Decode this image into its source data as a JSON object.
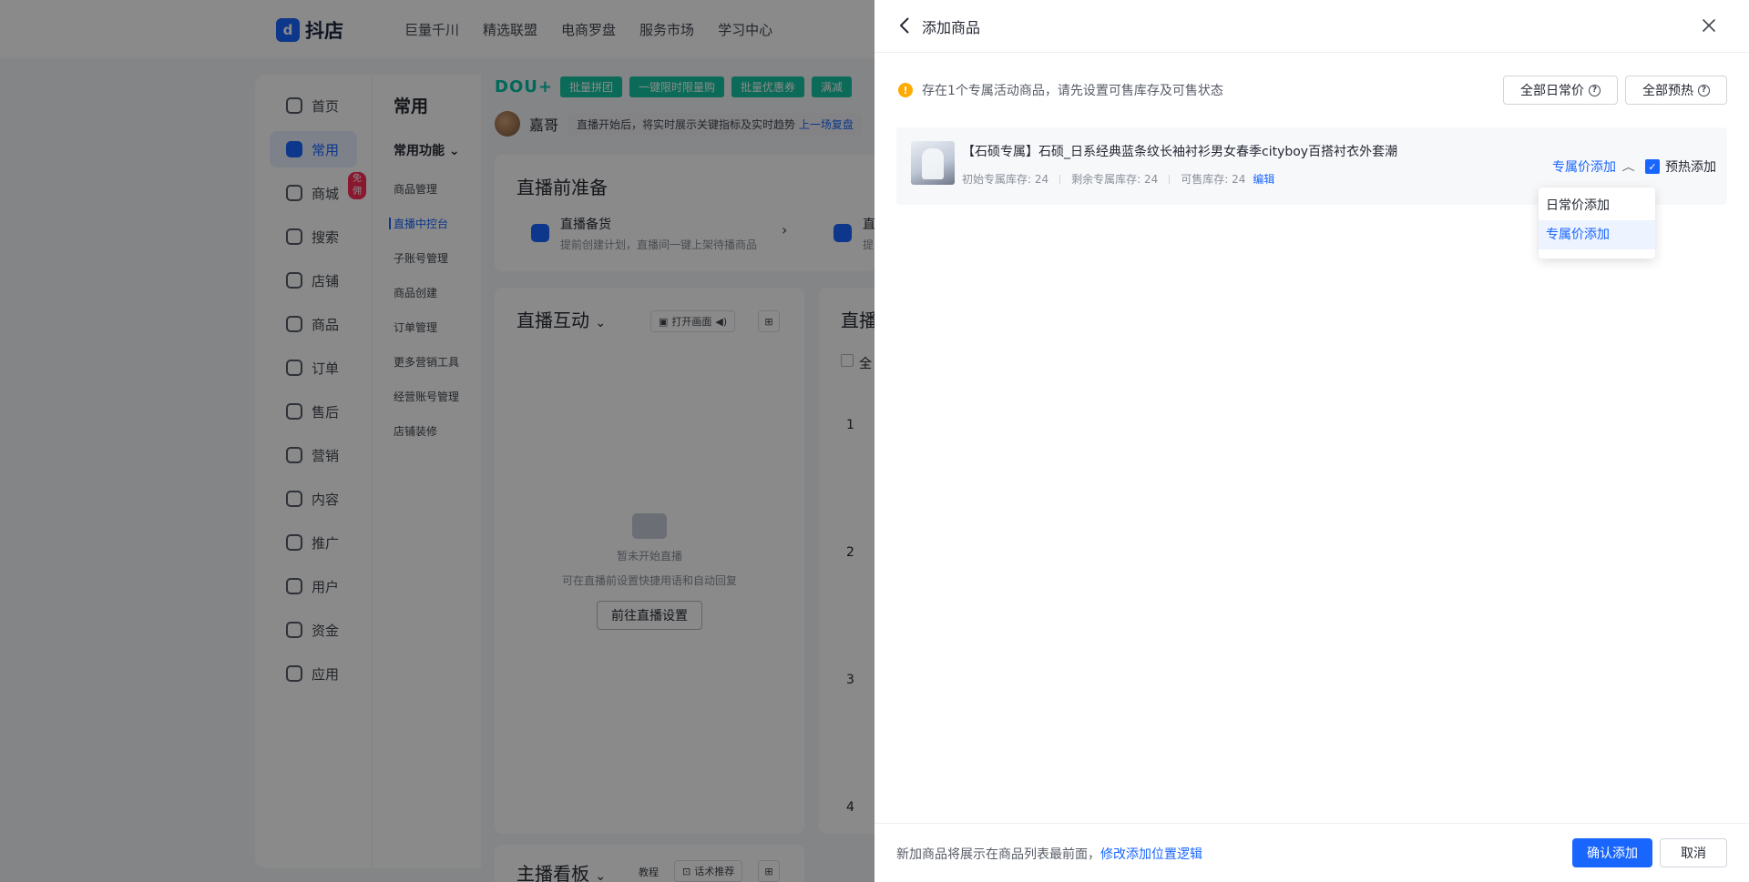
{
  "app": {
    "logo_text": "抖店",
    "top_nav": [
      "巨量千川",
      "精选联盟",
      "电商罗盘",
      "服务市场",
      "学习中心"
    ],
    "sidebar": [
      {
        "label": "首页"
      },
      {
        "label": "常用"
      },
      {
        "label": "商城",
        "badge": "免佣"
      },
      {
        "label": "搜索"
      },
      {
        "label": "店铺"
      },
      {
        "label": "商品"
      },
      {
        "label": "订单"
      },
      {
        "label": "售后"
      },
      {
        "label": "营销"
      },
      {
        "label": "内容"
      },
      {
        "label": "推广"
      },
      {
        "label": "用户"
      },
      {
        "label": "资金"
      },
      {
        "label": "应用"
      }
    ],
    "subnav": {
      "title": "常用",
      "group": "常用功能",
      "items": [
        "商品管理",
        "直播中控台",
        "子账号管理",
        "商品创建",
        "订单管理",
        "更多营销工具",
        "经营账号管理",
        "店铺装修"
      ]
    },
    "strip": {
      "brand": "DOU+",
      "buttons": [
        "批量拼团",
        "一键限时限量购",
        "批量优惠券",
        "满减"
      ]
    },
    "host": {
      "name": "嘉哥",
      "tip": "直播开始后，将实时展示关键指标及实时趋势",
      "tip_link": "上一场复盘"
    },
    "prep_card": {
      "title": "直播前准备",
      "item1_name": "直播备货",
      "item1_desc": "提前创建计划，直播间一键上架待播商品",
      "item2_name": "直",
      "item2_desc": "提"
    },
    "interact_card": {
      "title": "直播互动",
      "screen_btn": "打开画面",
      "empty_title": "暂未开始直播",
      "empty_desc": "可在直播前设置快捷用语和自动回复",
      "empty_btn": "前往直播设置"
    },
    "right_card": {
      "title": "直播",
      "check_label": "全",
      "rows": [
        "1",
        "2",
        "3",
        "4"
      ]
    },
    "board_card": {
      "title": "主播看板",
      "tutorial": "教程",
      "script_btn": "话术推荐"
    }
  },
  "drawer": {
    "title": "添加商品",
    "warning": "存在1个专属活动商品，请先设置可售库存及可售状态",
    "btn_daily_all": "全部日常价",
    "btn_preheat_all": "全部预热",
    "product": {
      "title": "【石硕专属】石硕_日系经典蓝条纹长袖衬衫男女春季cityboy百搭衬衣外套潮",
      "initial_stock": "初始专属库存: 24",
      "remaining_stock": "剩余专属库存: 24",
      "sellable_stock": "可售库存: 24",
      "edit": "编辑",
      "add_mode": "专属价添加",
      "preheat_label": "预热添加",
      "preheat_checked": true
    },
    "dropdown_options": [
      {
        "label": "日常价添加",
        "selected": false
      },
      {
        "label": "专属价添加",
        "selected": true
      }
    ],
    "footer": {
      "note": "新加商品将展示在商品列表最前面，",
      "note_link": "修改添加位置逻辑",
      "confirm": "确认添加",
      "cancel": "取消"
    }
  },
  "colors": {
    "primary": "#1966ff",
    "warning": "#ffaa00",
    "badge": "#fe2c55",
    "teal": "#16c6a3"
  }
}
